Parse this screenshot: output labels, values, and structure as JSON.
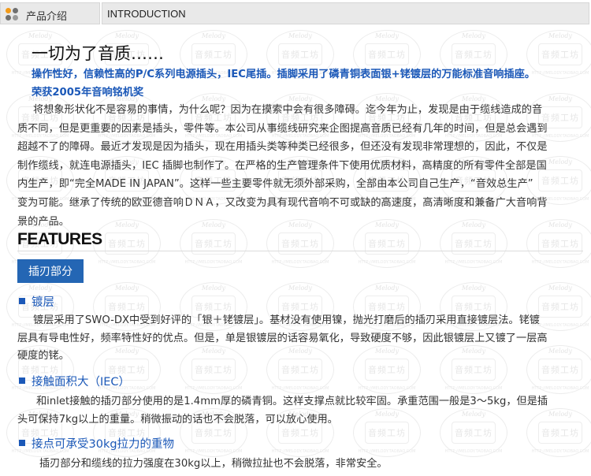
{
  "header": {
    "tab_label": "产品介绍",
    "section_title": "INTRODUCTION"
  },
  "watermark": {
    "top_text": "Melody",
    "mid_text": "音频工坊",
    "bottom_text": "HTTP://MELODY.TAOBAO.COM"
  },
  "intro": {
    "headline": "一切为了音质……",
    "subtitle_line1": "操作性好，信赖性高的P/C系列电源插头，IEC尾插。插脚采用了磷青铜表面银+铑镀层的万能标准音响插座。",
    "subtitle_line2": "荣获2005年音响铭机奖",
    "body_lines": [
      "将想象形状化不是容易的事情，为什么呢？因为在摸索中会有很多障碍。迄今年为止，发现是由于缆线造成的音",
      "质不同，但是更重要的因素是插头，零件等。本公司从事缆线研究来企图提高音质已经有几年的时间，但是总会遇到",
      "超越不了的障碍。最近才发现是因为插头，现在用插头类等种类已经很多，但还没有发现非常理想的，因此，不仅是",
      "制作缆线，就连电源插头，IEC 插脚也制作了。在严格的生产管理条件下使用优质材料，高精度的所有零件全部是国",
      "内生产，即“完全MADE IN JAPAN”。这样一些主要零件就无须外部采购，全部由本公司自己生产，“音效总生产”",
      "变为可能。继承了传统的欧亚德音响ＤＮＡ，又改变为具有现代音响不可或缺的高速度，高清晰度和兼备广大音响背",
      "景的产品。"
    ]
  },
  "features": {
    "title": "FEATURES",
    "badge": "插刃部分",
    "sections": [
      {
        "heading": "镀层",
        "lines": [
          "镀层采用了SWO-DX中受到好评的「银＋铑镀层」。基材没有使用镍，抛光打磨后的插刃采用直接镀层法。铑镀",
          "层具有导电性好，频率特性好的优点。但是，单是银镀层的话容易氧化，导致硬度不够，因此银镀层上又镀了一层高",
          "硬度的铑。"
        ]
      },
      {
        "heading": "接触面积大（IEC）",
        "lines": [
          "和inlet接触的插刃部分使用的是1.4mm厚的磷青铜。这样支撑点就比较牢固。承重范围一般是3～5kg，但是插",
          "头可保持7kg以上的重量。稍微振动的话也不会脱落，可以放心使用。"
        ]
      },
      {
        "heading": "接点可承受30kg拉力的重物",
        "lines": [
          "插刃部分和缆线的拉力强度在30kg以上，稍微拉扯也不会脱落，非常安全。"
        ]
      }
    ]
  },
  "colors": {
    "accent_blue": "#1b58b8",
    "badge_blue": "#2466b4",
    "bullet_orange": "#f29a18"
  }
}
